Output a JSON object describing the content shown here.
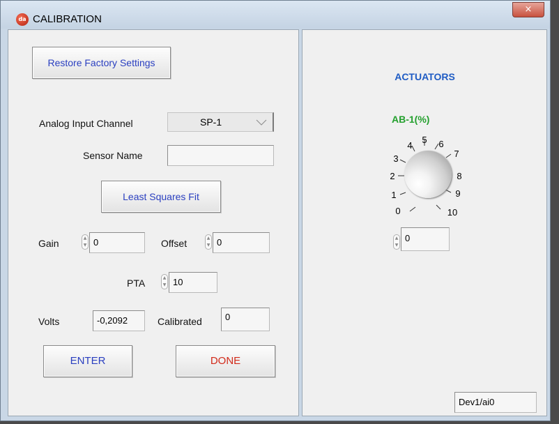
{
  "window": {
    "title": "CALIBRATION",
    "app_icon": "app-logo-icon",
    "close_glyph": "×"
  },
  "left": {
    "restore_label": "Restore Factory Settings",
    "channel_label": "Analog Input Channel",
    "channel_value": "SP-1",
    "sensor_name_label": "Sensor Name",
    "sensor_name_value": "",
    "least_squares_label": "Least Squares  Fit",
    "gain_label": "Gain",
    "gain_value": "0",
    "offset_label": "Offset",
    "offset_value": "0",
    "pta_label": "PTA",
    "pta_value": "10",
    "volts_label": "Volts",
    "volts_value": "-0,2092",
    "calibrated_label": "Calibrated",
    "calibrated_value": "0",
    "enter_label": "ENTER",
    "done_label": "DONE"
  },
  "right": {
    "heading": "ACTUATORS",
    "knob_label": "AB-1(%)",
    "knob_scale": [
      "0",
      "1",
      "2",
      "3",
      "4",
      "5",
      "6",
      "7",
      "8",
      "9",
      "10"
    ],
    "knob_value": "0",
    "device": "Dev1/ai0"
  },
  "colors": {
    "heading_blue": "#1f5cc4",
    "knob_label_green": "#24a02e",
    "button_blue": "#2a3fc0",
    "done_red": "#d22a1a"
  }
}
